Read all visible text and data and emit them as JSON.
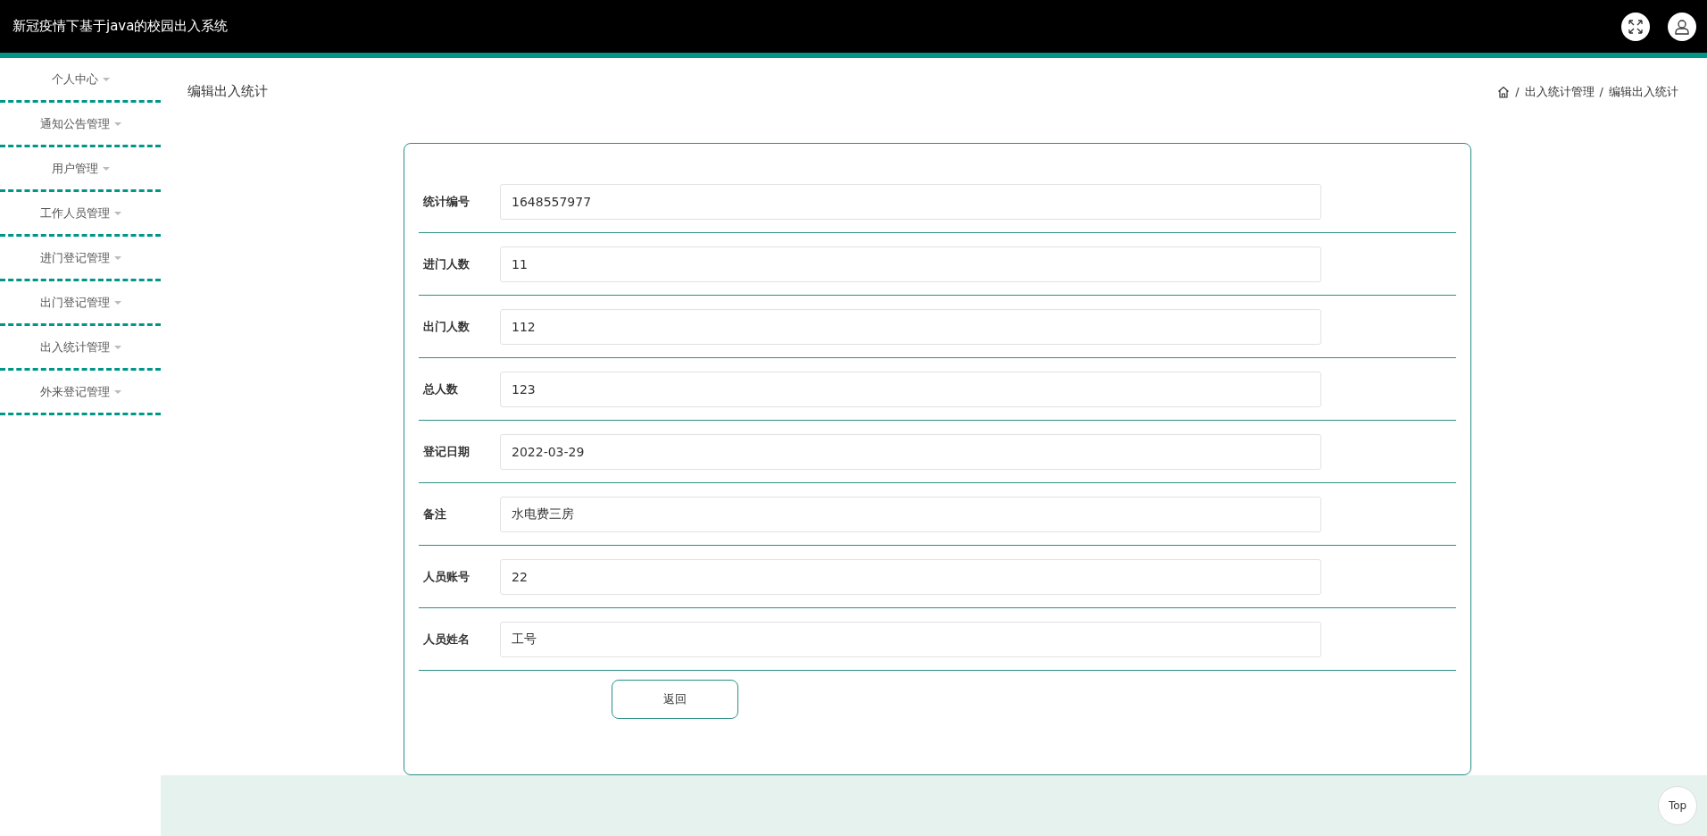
{
  "header": {
    "title": "新冠疫情下基于java的校园出入系统"
  },
  "sidebar": {
    "items": [
      {
        "label": "个人中心"
      },
      {
        "label": "通知公告管理"
      },
      {
        "label": "用户管理"
      },
      {
        "label": "工作人员管理"
      },
      {
        "label": "进门登记管理"
      },
      {
        "label": "出门登记管理"
      },
      {
        "label": "出入统计管理"
      },
      {
        "label": "外来登记管理"
      }
    ]
  },
  "page_title": "编辑出入统计",
  "breadcrumb": {
    "separator": "/",
    "items": [
      "出入统计管理",
      "编辑出入统计"
    ]
  },
  "form": {
    "fields": [
      {
        "label": "统计编号",
        "value": "1648557977"
      },
      {
        "label": "进门人数",
        "value": "11"
      },
      {
        "label": "出门人数",
        "value": "112"
      },
      {
        "label": "总人数",
        "value": "123"
      },
      {
        "label": "登记日期",
        "value": "2022-03-29"
      },
      {
        "label": "备注",
        "value": "水电费三房"
      },
      {
        "label": "人员账号",
        "value": "22"
      },
      {
        "label": "人员姓名",
        "value": "工号"
      }
    ],
    "buttons": [
      "返回"
    ]
  },
  "top_button": "Top"
}
